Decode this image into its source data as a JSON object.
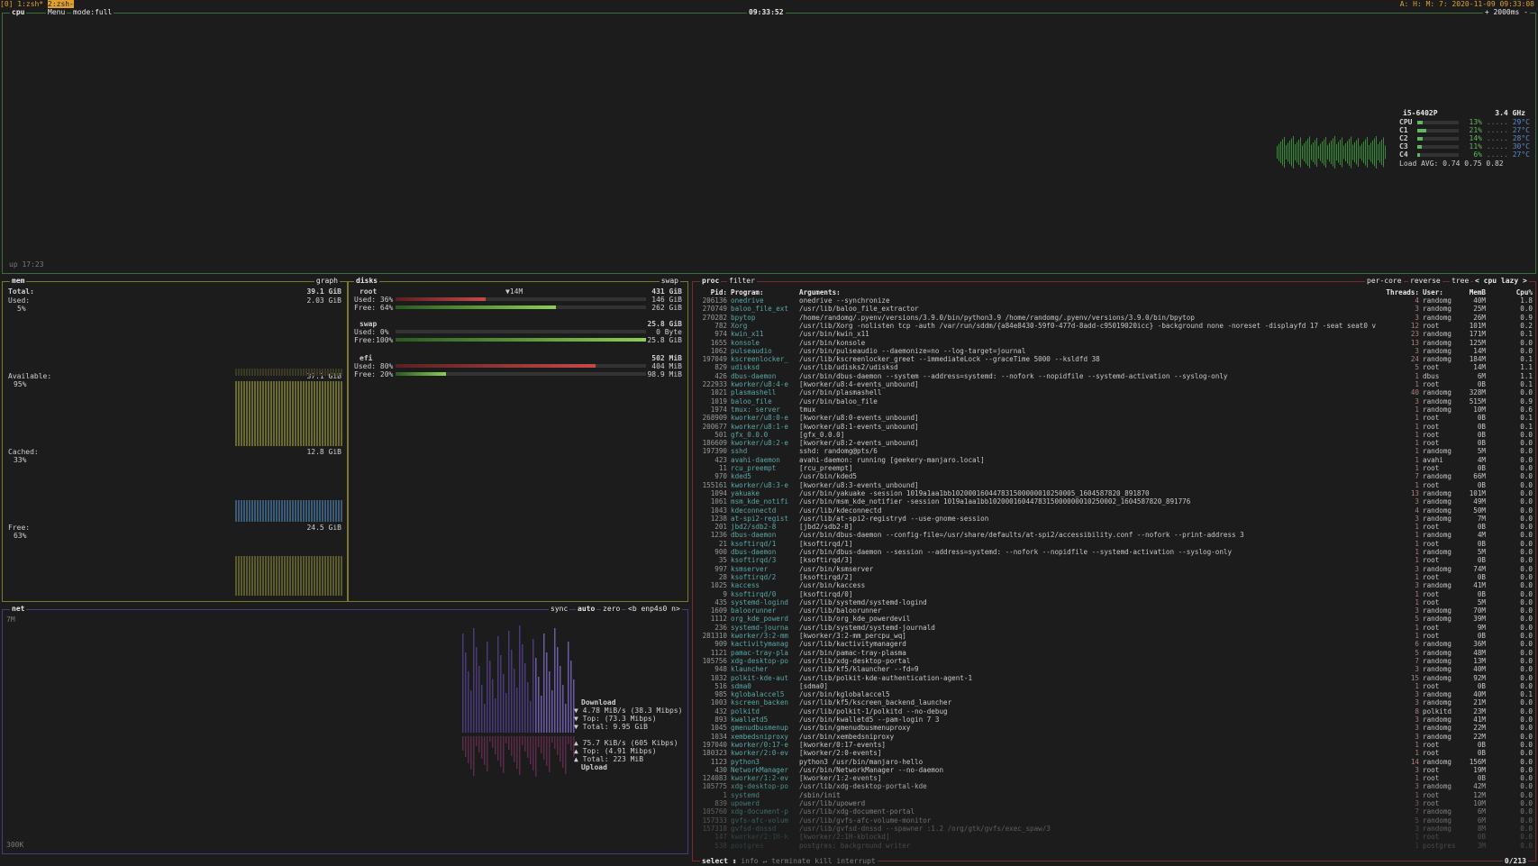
{
  "tmux": {
    "session": "[0] 1:zsh*",
    "window2": "2:zsh-",
    "right": "A: H: M: 7: 2020-11-09 09:33:08"
  },
  "cpu": {
    "title": "cpu",
    "menu": "Menu",
    "mode": "mode:full",
    "clock": "09:33:52",
    "interval": "+ 2000ms -",
    "uptime": "up 17:23",
    "model": "i5-6402P",
    "freq": "3.4 GHz",
    "cores": [
      {
        "name": "CPU",
        "pct": "13%",
        "temp": "29°C",
        "fill": 0.13
      },
      {
        "name": "C1",
        "pct": "21%",
        "temp": "27°C",
        "fill": 0.21
      },
      {
        "name": "C2",
        "pct": "14%",
        "temp": "28°C",
        "fill": 0.14
      },
      {
        "name": "C3",
        "pct": "11%",
        "temp": "30°C",
        "fill": 0.11
      },
      {
        "name": "C4",
        "pct": "6%",
        "temp": "27°C",
        "fill": 0.06
      }
    ],
    "load": "Load AVG:  0.74   0.75   0.82"
  },
  "mem": {
    "title": "mem",
    "graph": "graph",
    "total_label": "Total:",
    "total": "39.1 GiB",
    "used_label": "Used:",
    "used": "2.03 GiB",
    "used_pct": "5%",
    "avail_label": "Available:",
    "avail": "37.1 GiB",
    "avail_pct": "95%",
    "cached_label": "Cached:",
    "cached": "12.8 GiB",
    "cached_pct": "33%",
    "free_label": "Free:",
    "free": "24.5 GiB",
    "free_pct": "63%"
  },
  "disks": {
    "title": "disks",
    "swap_tag": "swap",
    "io": "▼14M",
    "items": [
      {
        "name": "root",
        "size": "431 GiB",
        "used_label": "Used: 36%",
        "used": "146 GiB",
        "used_fill": 0.36,
        "free_label": "Free: 64%",
        "free": "262 GiB",
        "free_fill": 0.64
      },
      {
        "name": "swap",
        "size": "25.8 GiB",
        "used_label": "Used:  0%",
        "used": "0 Byte",
        "used_fill": 0.0,
        "free_label": "Free:100%",
        "free": "25.8 GiB",
        "free_fill": 1.0
      },
      {
        "name": "efi",
        "size": "502 MiB",
        "used_label": "Used: 80%",
        "used": "404 MiB",
        "used_fill": 0.8,
        "free_label": "Free: 20%",
        "free": "98.9 MiB",
        "free_fill": 0.2
      }
    ]
  },
  "net": {
    "title": "net",
    "sync": "sync",
    "auto": "auto",
    "zero": "zero",
    "iface": "<b enp4s0 n>",
    "top_scale": "7M",
    "bottom_scale": "300K",
    "download_label": "Download",
    "dl_rate": "▼ 4.78 MiB/s (38.3 Mibps)",
    "dl_top": "▼ Top:       (73.3 Mibps)",
    "dl_total": "▼ Total:         9.95 GiB",
    "ul_rate": "▲ 75.7 KiB/s  (605 Kibps)",
    "ul_top": "▲ Top:       (4.91 Mibps)",
    "ul_total": "▲ Total:          223 MiB",
    "upload_label": "Upload"
  },
  "proc": {
    "title": "proc",
    "filter": "filter",
    "opts_percore": "per-core",
    "opts_reverse": "reverse",
    "opts_tree": "tree",
    "opts_sort": "< cpu lazy >",
    "headers": {
      "pid": "Pid:",
      "program": "Program:",
      "args": "Arguments:",
      "threads": "Threads:",
      "user": "User:",
      "mem": "MemB",
      "cpu": "Cpu%"
    },
    "rows": [
      {
        "pid": "206136",
        "prog": "onedrive",
        "args": "onedrive --synchronize",
        "thr": "4",
        "user": "randomg",
        "mem": "40M",
        "cpu": "1.8"
      },
      {
        "pid": "270749",
        "prog": "baloo_file_ext",
        "args": "/usr/lib/baloo_file_extractor",
        "thr": "3",
        "user": "randomg",
        "mem": "25M",
        "cpu": "0.0"
      },
      {
        "pid": "270282",
        "prog": "bpytop",
        "args": "/home/randomg/.pyenv/versions/3.9.0/bin/python3.9 /home/randomg/.pyenv/versions/3.9.0/bin/bpytop",
        "thr": "3",
        "user": "randomg",
        "mem": "26M",
        "cpu": "0.9"
      },
      {
        "pid": "782",
        "prog": "Xorg",
        "args": "/usr/lib/Xorg -nolisten tcp -auth /var/run/sddm/{a84e8430-59f0-477d-8add-c95019020icc} -background none -noreset -displayfd 17 -seat seat0 vt1",
        "thr": "12",
        "user": "root",
        "mem": "101M",
        "cpu": "0.2"
      },
      {
        "pid": "974",
        "prog": "kwin_x11",
        "args": "/usr/bin/kwin_x11",
        "thr": "23",
        "user": "randomg",
        "mem": "171M",
        "cpu": "0.1"
      },
      {
        "pid": "1655",
        "prog": "konsole",
        "args": "/usr/bin/konsole",
        "thr": "13",
        "user": "randomg",
        "mem": "125M",
        "cpu": "0.0"
      },
      {
        "pid": "1062",
        "prog": "pulseaudio",
        "args": "/usr/bin/pulseaudio --daemonize=no --log-target=journal",
        "thr": "3",
        "user": "randomg",
        "mem": "14M",
        "cpu": "0.0"
      },
      {
        "pid": "197049",
        "prog": "kscreenlocker_",
        "args": "/usr/lib/kscreenlocker_greet --immediateLock --graceTime 5000 --ksldfd 38",
        "thr": "24",
        "user": "randomg",
        "mem": "184M",
        "cpu": "0.1"
      },
      {
        "pid": "829",
        "prog": "udisksd",
        "args": "/usr/lib/udisks2/udisksd",
        "thr": "5",
        "user": "root",
        "mem": "14M",
        "cpu": "1.1"
      },
      {
        "pid": "426",
        "prog": "dbus-daemon",
        "args": "/usr/bin/dbus-daemon --system --address=systemd: --nofork --nopidfile --systemd-activation --syslog-only",
        "thr": "1",
        "user": "dbus",
        "mem": "6M",
        "cpu": "1.1"
      },
      {
        "pid": "222933",
        "prog": "kworker/u8:4-e",
        "args": "[kworker/u8:4-events_unbound]",
        "thr": "1",
        "user": "root",
        "mem": "0B",
        "cpu": "0.1"
      },
      {
        "pid": "1021",
        "prog": "plasmashell",
        "args": "/usr/bin/plasmashell",
        "thr": "40",
        "user": "randomg",
        "mem": "328M",
        "cpu": "0.0"
      },
      {
        "pid": "1019",
        "prog": "baloo_file",
        "args": "/usr/bin/baloo_file",
        "thr": "3",
        "user": "randomg",
        "mem": "515M",
        "cpu": "0.9"
      },
      {
        "pid": "1974",
        "prog": "tmux: server",
        "args": "tmux",
        "thr": "1",
        "user": "randomg",
        "mem": "10M",
        "cpu": "0.6"
      },
      {
        "pid": "268909",
        "prog": "kworker/u8:0-e",
        "args": "[kworker/u8:0-events_unbound]",
        "thr": "1",
        "user": "root",
        "mem": "0B",
        "cpu": "0.1"
      },
      {
        "pid": "200677",
        "prog": "kworker/u8:1-e",
        "args": "[kworker/u8:1-events_unbound]",
        "thr": "1",
        "user": "root",
        "mem": "0B",
        "cpu": "0.1"
      },
      {
        "pid": "501",
        "prog": "gfx_0.0.0",
        "args": "[gfx_0.0.0]",
        "thr": "1",
        "user": "root",
        "mem": "0B",
        "cpu": "0.0"
      },
      {
        "pid": "186609",
        "prog": "kworker/u8:2-e",
        "args": "[kworker/u8:2-events_unbound]",
        "thr": "1",
        "user": "root",
        "mem": "0B",
        "cpu": "0.0"
      },
      {
        "pid": "197390",
        "prog": "sshd",
        "args": "sshd: randomg@pts/6",
        "thr": "1",
        "user": "randomg",
        "mem": "5M",
        "cpu": "0.0"
      },
      {
        "pid": "423",
        "prog": "avahi-daemon",
        "args": "avahi-daemon: running [geekery-manjaro.local]",
        "thr": "1",
        "user": "avahi",
        "mem": "4M",
        "cpu": "0.0"
      },
      {
        "pid": "11",
        "prog": "rcu_preempt",
        "args": "[rcu_preempt]",
        "thr": "1",
        "user": "root",
        "mem": "0B",
        "cpu": "0.0"
      },
      {
        "pid": "970",
        "prog": "kded5",
        "args": "/usr/bin/kded5",
        "thr": "7",
        "user": "randomg",
        "mem": "66M",
        "cpu": "0.0"
      },
      {
        "pid": "155161",
        "prog": "kworker/u8:3-e",
        "args": "[kworker/u8:3-events_unbound]",
        "thr": "1",
        "user": "root",
        "mem": "0B",
        "cpu": "0.0"
      },
      {
        "pid": "1094",
        "prog": "yakuake",
        "args": "/usr/bin/yakuake -session 1019a1aa1bb102000160447831500000010250005_1604587820_891870",
        "thr": "13",
        "user": "randomg",
        "mem": "101M",
        "cpu": "0.0"
      },
      {
        "pid": "1061",
        "prog": "msm_kde_notifi",
        "args": "/usr/bin/msm_kde_notifier -session 1019a1aa1bb1020001604478315000000010250002_1604587820_891776",
        "thr": "3",
        "user": "randomg",
        "mem": "49M",
        "cpu": "0.0"
      },
      {
        "pid": "1043",
        "prog": "kdeconnectd",
        "args": "/usr/lib/kdeconnectd",
        "thr": "4",
        "user": "randomg",
        "mem": "50M",
        "cpu": "0.0"
      },
      {
        "pid": "1238",
        "prog": "at-spi2-regist",
        "args": "/usr/lib/at-spi2-registryd --use-gnome-session",
        "thr": "3",
        "user": "randomg",
        "mem": "7M",
        "cpu": "0.0"
      },
      {
        "pid": "201",
        "prog": "jbd2/sdb2-8",
        "args": "[jbd2/sdb2-8]",
        "thr": "1",
        "user": "root",
        "mem": "0B",
        "cpu": "0.0"
      },
      {
        "pid": "1236",
        "prog": "dbus-daemon",
        "args": "/usr/bin/dbus-daemon --config-file=/usr/share/defaults/at-spi2/accessibility.conf --nofork --print-address 3",
        "thr": "1",
        "user": "randomg",
        "mem": "4M",
        "cpu": "0.0"
      },
      {
        "pid": "21",
        "prog": "ksoftirqd/1",
        "args": "[ksoftirqd/1]",
        "thr": "1",
        "user": "root",
        "mem": "0B",
        "cpu": "0.0"
      },
      {
        "pid": "900",
        "prog": "dbus-daemon",
        "args": "/usr/bin/dbus-daemon --session --address=systemd: --nofork --nopidfile --systemd-activation --syslog-only",
        "thr": "1",
        "user": "randomg",
        "mem": "5M",
        "cpu": "0.0"
      },
      {
        "pid": "35",
        "prog": "ksoftirqd/3",
        "args": "[ksoftirqd/3]",
        "thr": "1",
        "user": "root",
        "mem": "0B",
        "cpu": "0.0"
      },
      {
        "pid": "997",
        "prog": "ksmserver",
        "args": "/usr/bin/ksmserver",
        "thr": "3",
        "user": "randomg",
        "mem": "74M",
        "cpu": "0.0"
      },
      {
        "pid": "28",
        "prog": "ksoftirqd/2",
        "args": "[ksoftirqd/2]",
        "thr": "1",
        "user": "root",
        "mem": "0B",
        "cpu": "0.0"
      },
      {
        "pid": "1025",
        "prog": "kaccess",
        "args": "/usr/bin/kaccess",
        "thr": "3",
        "user": "randomg",
        "mem": "41M",
        "cpu": "0.0"
      },
      {
        "pid": "9",
        "prog": "ksoftirqd/0",
        "args": "[ksoftirqd/0]",
        "thr": "1",
        "user": "root",
        "mem": "0B",
        "cpu": "0.0"
      },
      {
        "pid": "435",
        "prog": "systemd-logind",
        "args": "/usr/lib/systemd/systemd-logind",
        "thr": "1",
        "user": "root",
        "mem": "5M",
        "cpu": "0.0"
      },
      {
        "pid": "1609",
        "prog": "baloorunner",
        "args": "/usr/lib/baloorunner",
        "thr": "3",
        "user": "randomg",
        "mem": "70M",
        "cpu": "0.0"
      },
      {
        "pid": "1112",
        "prog": "org_kde_powerd",
        "args": "/usr/lib/org_kde_powerdevil",
        "thr": "5",
        "user": "randomg",
        "mem": "39M",
        "cpu": "0.0"
      },
      {
        "pid": "236",
        "prog": "systemd-journa",
        "args": "/usr/lib/systemd/systemd-journald",
        "thr": "1",
        "user": "root",
        "mem": "9M",
        "cpu": "0.0"
      },
      {
        "pid": "281310",
        "prog": "kworker/3:2-mm",
        "args": "[kworker/3:2-mm_percpu_wq]",
        "thr": "1",
        "user": "root",
        "mem": "0B",
        "cpu": "0.0"
      },
      {
        "pid": "909",
        "prog": "kactivitymanag",
        "args": "/usr/lib/kactivitymanagerd",
        "thr": "6",
        "user": "randomg",
        "mem": "36M",
        "cpu": "0.0"
      },
      {
        "pid": "1121",
        "prog": "pamac-tray-pla",
        "args": "/usr/bin/pamac-tray-plasma",
        "thr": "5",
        "user": "randomg",
        "mem": "48M",
        "cpu": "0.0"
      },
      {
        "pid": "105756",
        "prog": "xdg-desktop-po",
        "args": "/usr/lib/xdg-desktop-portal",
        "thr": "7",
        "user": "randomg",
        "mem": "13M",
        "cpu": "0.0"
      },
      {
        "pid": "948",
        "prog": "klauncher",
        "args": "/usr/lib/kf5/klauncher --fd=9",
        "thr": "3",
        "user": "randomg",
        "mem": "40M",
        "cpu": "0.0"
      },
      {
        "pid": "1032",
        "prog": "polkit-kde-aut",
        "args": "/usr/lib/polkit-kde-authentication-agent-1",
        "thr": "15",
        "user": "randomg",
        "mem": "92M",
        "cpu": "0.0"
      },
      {
        "pid": "516",
        "prog": "sdma0",
        "args": "[sdma0]",
        "thr": "1",
        "user": "root",
        "mem": "0B",
        "cpu": "0.0"
      },
      {
        "pid": "985",
        "prog": "kglobalaccel5",
        "args": "/usr/bin/kglobalaccel5",
        "thr": "3",
        "user": "randomg",
        "mem": "40M",
        "cpu": "0.1"
      },
      {
        "pid": "1003",
        "prog": "kscreen_backen",
        "args": "/usr/lib/kf5/kscreen_backend_launcher",
        "thr": "3",
        "user": "randomg",
        "mem": "21M",
        "cpu": "0.0"
      },
      {
        "pid": "432",
        "prog": "polkitd",
        "args": "/usr/lib/polkit-1/polkitd --no-debug",
        "thr": "8",
        "user": "polkitd",
        "mem": "23M",
        "cpu": "0.0"
      },
      {
        "pid": "893",
        "prog": "kwalletd5",
        "args": "/usr/bin/kwalletd5 --pam-login 7 3",
        "thr": "3",
        "user": "randomg",
        "mem": "41M",
        "cpu": "0.0"
      },
      {
        "pid": "1045",
        "prog": "gmenudbusmenup",
        "args": "/usr/bin/gmenudbusmenuproxy",
        "thr": "3",
        "user": "randomg",
        "mem": "22M",
        "cpu": "0.0"
      },
      {
        "pid": "1034",
        "prog": "xembedsniproxy",
        "args": "/usr/bin/xembedsniproxy",
        "thr": "3",
        "user": "randomg",
        "mem": "22M",
        "cpu": "0.0"
      },
      {
        "pid": "197040",
        "prog": "kworker/0:17-e",
        "args": "[kworker/0:17-events]",
        "thr": "1",
        "user": "root",
        "mem": "0B",
        "cpu": "0.0"
      },
      {
        "pid": "180323",
        "prog": "kworker/2:0-ev",
        "args": "[kworker/2:0-events]",
        "thr": "1",
        "user": "root",
        "mem": "0B",
        "cpu": "0.0"
      },
      {
        "pid": "1123",
        "prog": "python3",
        "args": "python3 /usr/bin/manjaro-hello",
        "thr": "14",
        "user": "randomg",
        "mem": "156M",
        "cpu": "0.0"
      },
      {
        "pid": "430",
        "prog": "NetworkManager",
        "args": "/usr/bin/NetworkManager --no-daemon",
        "thr": "3",
        "user": "root",
        "mem": "19M",
        "cpu": "0.0"
      },
      {
        "pid": "124083",
        "prog": "kworker/1:2-ev",
        "args": "[kworker/1:2-events]",
        "thr": "1",
        "user": "root",
        "mem": "0B",
        "cpu": "0.0"
      },
      {
        "pid": "105775",
        "prog": "xdg-desktop-po",
        "args": "/usr/lib/xdg-desktop-portal-kde",
        "thr": "3",
        "user": "randomg",
        "mem": "42M",
        "cpu": "0.0"
      },
      {
        "pid": "1",
        "prog": "systemd",
        "args": "/sbin/init",
        "thr": "1",
        "user": "root",
        "mem": "12M",
        "cpu": "0.0"
      },
      {
        "pid": "839",
        "prog": "upowerd",
        "args": "/usr/lib/upowerd",
        "thr": "3",
        "user": "root",
        "mem": "10M",
        "cpu": "0.0"
      },
      {
        "pid": "105760",
        "prog": "xdg-document-p",
        "args": "/usr/lib/xdg-document-portal",
        "thr": "7",
        "user": "randomg",
        "mem": "6M",
        "cpu": "0.0"
      },
      {
        "pid": "157333",
        "prog": "gvfs-afc-volum",
        "args": "/usr/lib/gvfs-afc-volume-monitor",
        "thr": "5",
        "user": "randomg",
        "mem": "6M",
        "cpu": "0.0"
      },
      {
        "pid": "157318",
        "prog": "gvfsd-dnssd",
        "args": "/usr/lib/gvfsd-dnssd --spawner :1.2 /org/gtk/gvfs/exec_spaw/3",
        "thr": "3",
        "user": "randomg",
        "mem": "8M",
        "cpu": "0.0"
      },
      {
        "pid": "147",
        "prog": "kworker/2:1H-k",
        "args": "[kworker/2:1H-kblockd]",
        "thr": "1",
        "user": "root",
        "mem": "0B",
        "cpu": "0.0"
      },
      {
        "pid": "538",
        "prog": "postgres",
        "args": "postgres: background writer",
        "thr": "1",
        "user": "postgres",
        "mem": "3M",
        "cpu": "0.0"
      }
    ],
    "footer_select": "select ↕",
    "footer_info": "info ↵",
    "footer_terminate": "terminate",
    "footer_kill": "kill",
    "footer_interrupt": "interrupt",
    "count": "0/213"
  },
  "colors": {
    "cpu_border": "#3a6f3a",
    "mem_border": "#7a7a2a",
    "net_border": "#4a3a7a",
    "proc_border": "#7a2a2a",
    "accent": "#e0a030"
  }
}
